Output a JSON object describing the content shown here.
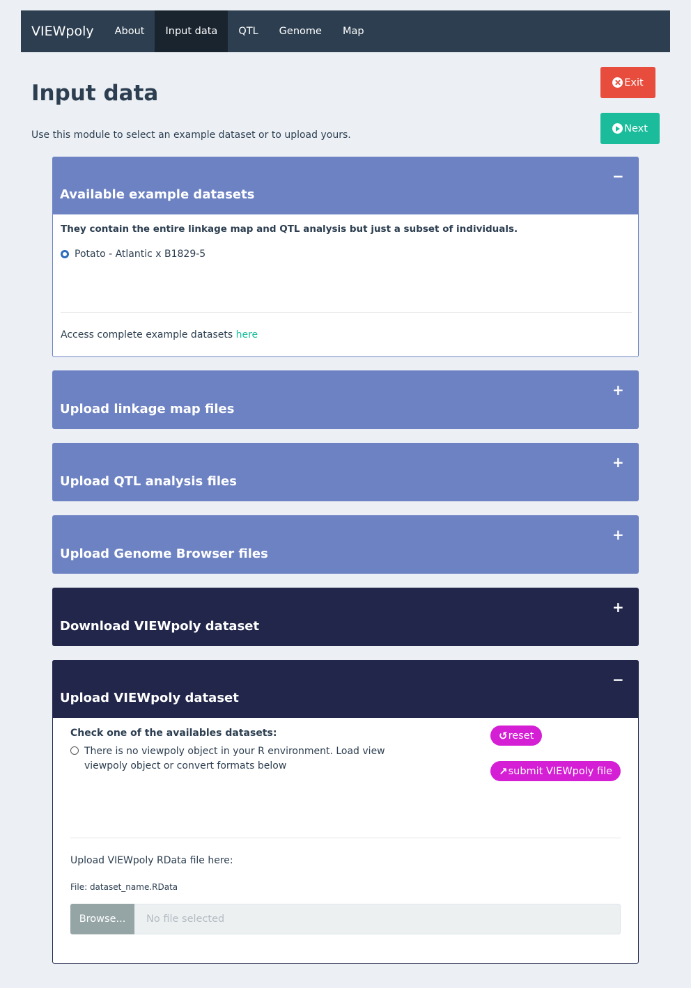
{
  "navbar": {
    "brand": "VIEWpoly",
    "items": [
      {
        "label": "About"
      },
      {
        "label": "Input data"
      },
      {
        "label": "QTL"
      },
      {
        "label": "Genome"
      },
      {
        "label": "Map"
      }
    ],
    "active": "Input data"
  },
  "page": {
    "title": "Input data",
    "intro": "Use this module to select an example dataset or to upload yours."
  },
  "actions": {
    "exit_label": "Exit",
    "next_label": "Next"
  },
  "example_box": {
    "title": "Available example datasets",
    "toggle": "−",
    "description": "They contain the entire linkage map and QTL analysis but just a subset of individuals.",
    "options": [
      {
        "label": "Potato - Atlantic x B1829-5",
        "selected": true
      }
    ],
    "access_text": "Access complete example datasets ",
    "access_link": "here"
  },
  "collapsed_boxes": [
    {
      "title": "Upload linkage map files",
      "toggle": "+"
    },
    {
      "title": "Upload QTL analysis files",
      "toggle": "+"
    },
    {
      "title": "Upload Genome Browser files",
      "toggle": "+"
    },
    {
      "title": "Download VIEWpoly dataset",
      "toggle": "+"
    }
  ],
  "viewpoly_box": {
    "title": "Upload VIEWpoly dataset",
    "toggle": "−",
    "check_label": "Check one of the availables datasets:",
    "radio_text": "There is no viewpoly object in your R environment. Load view viewpoly object or convert formats below",
    "reset_label": "reset",
    "submit_label": "submit VIEWpoly file",
    "upload_label": "Upload VIEWpoly RData file here:",
    "file_hint": "File: dataset_name.RData",
    "browse_label": "Browse...",
    "file_placeholder": "No file selected"
  },
  "colors": {
    "navbar": "#2c3e50",
    "box_light": "#6d82c2",
    "box_dark": "#22264b",
    "exit": "#e74c3c",
    "next": "#1abc9c",
    "pill": "#d41fd4",
    "link": "#18bc9c"
  }
}
